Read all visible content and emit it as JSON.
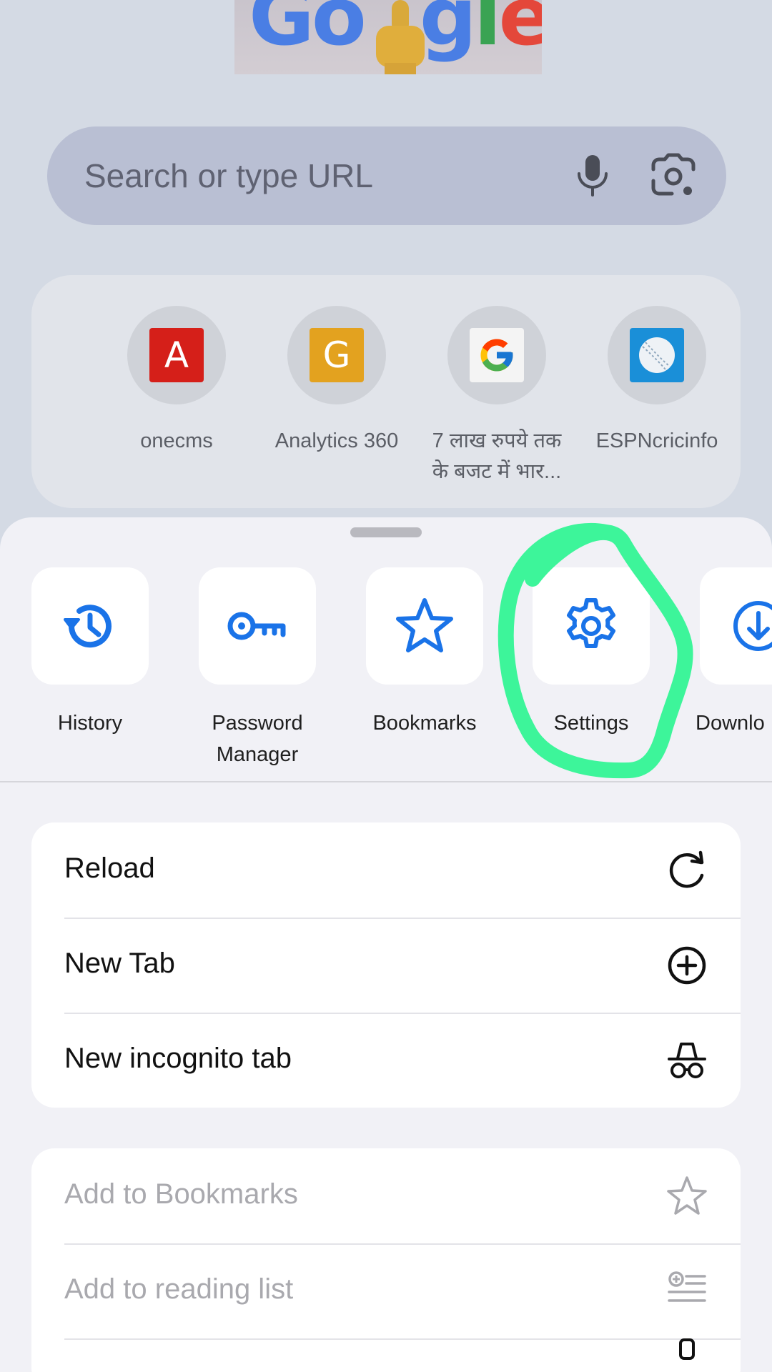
{
  "colors": {
    "accent": "#1a73e8",
    "page_bg": "#d4dae4",
    "sheet_bg": "#f1f1f6",
    "highlight": "#3df59a",
    "disabled_text": "#a9a9ae"
  },
  "doodle": {
    "text_1": "Go",
    "text_2": "gle",
    "icon": "raised-finger-icon"
  },
  "search": {
    "placeholder": "Search or type URL",
    "mic_icon": "microphone-icon",
    "lens_icon": "google-lens-icon"
  },
  "shortcuts": [
    {
      "label": "onecms",
      "logo_text": "A",
      "logo_color": "#d51f19"
    },
    {
      "label": "Analytics 360",
      "logo_text": "G",
      "logo_color": "#e3a21f"
    },
    {
      "label_line1": "7 लाख रुपये तक",
      "label_line2": "के बजट में भार...",
      "logo_text": "G",
      "logo_color": "#ffffff"
    },
    {
      "label": "ESPNcricinfo",
      "logo_text": "",
      "logo_color": "#1a8fd8"
    }
  ],
  "actions": [
    {
      "label": "History",
      "icon": "history-icon"
    },
    {
      "label_line1": "Password",
      "label_line2": "Manager",
      "icon": "key-icon"
    },
    {
      "label": "Bookmarks",
      "icon": "star-icon"
    },
    {
      "label": "Settings",
      "icon": "gear-icon",
      "highlighted": true
    },
    {
      "label": "Downlo",
      "icon": "download-icon"
    }
  ],
  "menu_primary": [
    {
      "label": "Reload",
      "icon": "reload-icon"
    },
    {
      "label": "New Tab",
      "icon": "plus-circle-icon"
    },
    {
      "label": "New incognito tab",
      "icon": "incognito-icon"
    }
  ],
  "menu_secondary": [
    {
      "label": "Add to Bookmarks",
      "icon": "star-outline-icon",
      "disabled": true
    },
    {
      "label": "Add to reading list",
      "icon": "reading-list-icon",
      "disabled": true
    }
  ]
}
